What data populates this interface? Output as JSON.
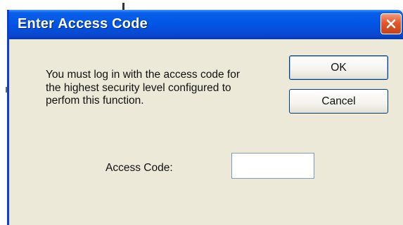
{
  "window": {
    "title": "Enter Access Code",
    "close_icon": "close-x-icon"
  },
  "message": {
    "text": "You must log in with the access code for the highest security level configured to perfom this function."
  },
  "buttons": {
    "ok_label": "OK",
    "cancel_label": "Cancel"
  },
  "access_code": {
    "label": "Access Code:",
    "value": ""
  },
  "colors": {
    "titlebar": "#0055e5",
    "dialog_background": "#ece9d8",
    "close_button": "#e3582a"
  }
}
